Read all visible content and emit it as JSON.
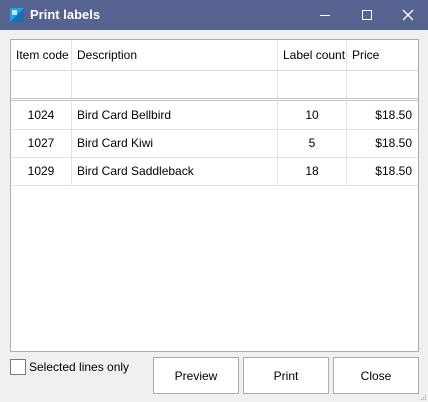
{
  "window": {
    "title": "Print labels",
    "icon": "print-labels-icon"
  },
  "grid": {
    "columns": [
      "Item code",
      "Description",
      "Label count",
      "Price"
    ],
    "rows": [
      {
        "item_code": "1024",
        "description": "Bird Card Bellbird",
        "label_count": "10",
        "price": "$18.50"
      },
      {
        "item_code": "1027",
        "description": "Bird Card Kiwi",
        "label_count": "5",
        "price": "$18.50"
      },
      {
        "item_code": "1029",
        "description": "Bird Card Saddleback",
        "label_count": "18",
        "price": "$18.50"
      }
    ]
  },
  "footer": {
    "selected_only_label": "Selected lines only",
    "selected_only_checked": false,
    "preview_label": "Preview",
    "print_label": "Print",
    "close_label": "Close"
  },
  "colors": {
    "titlebar": "#56628f",
    "window_bg": "#f0f0f0"
  }
}
